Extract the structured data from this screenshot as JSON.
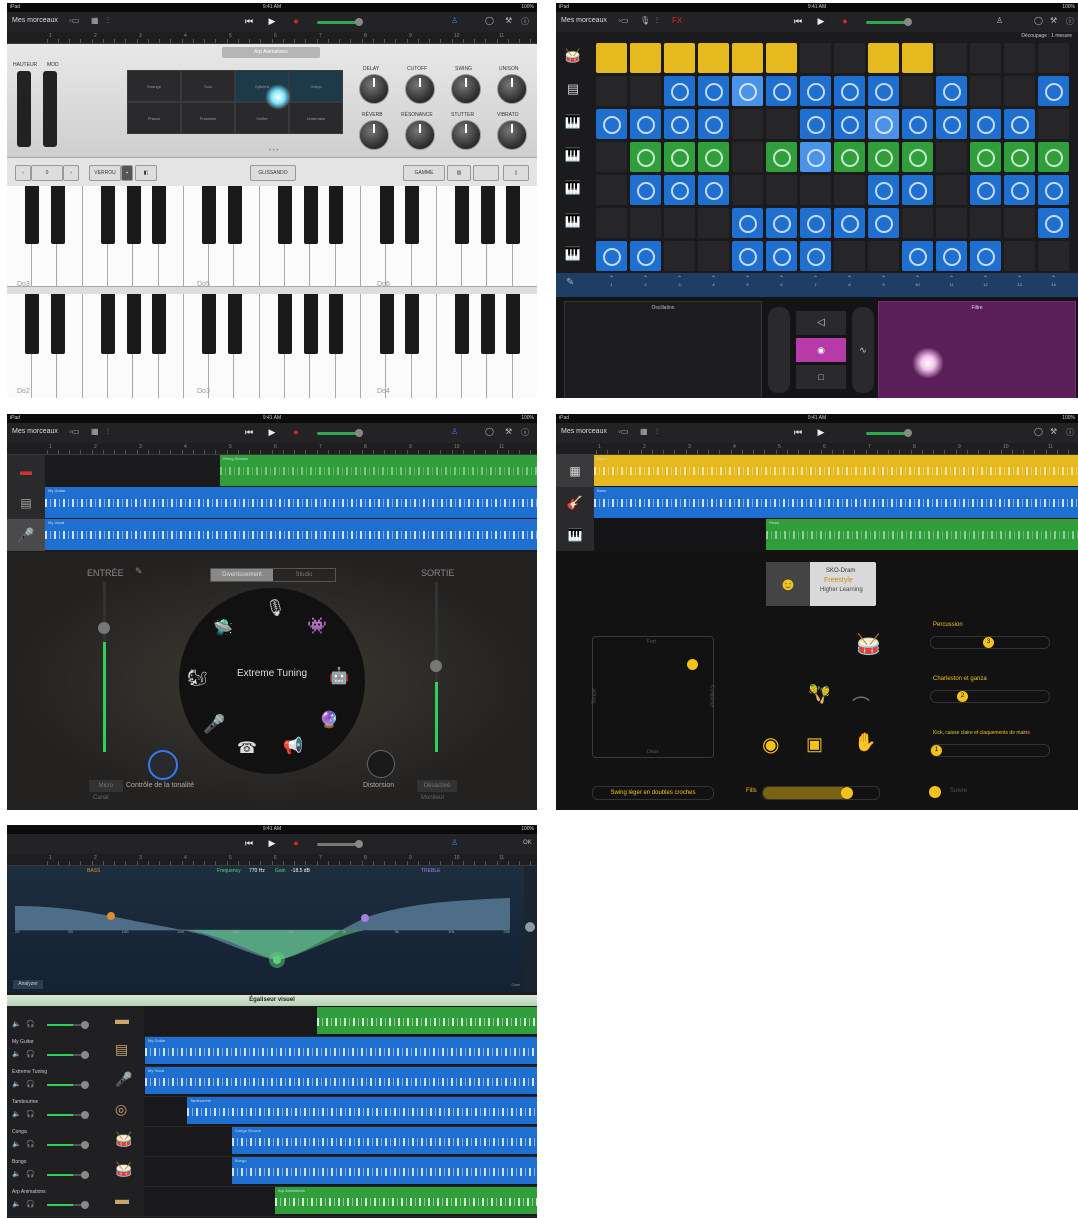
{
  "status": {
    "carrier": "iPad",
    "time": "9:41 AM",
    "battery": "100%"
  },
  "toolbar": {
    "songs_label": "Mes morceaux",
    "fx_label": "FX",
    "ok_label": "OK"
  },
  "ruler_numbers": [
    "1",
    "2",
    "3",
    "4",
    "5",
    "6",
    "7",
    "8",
    "9",
    "10",
    "11"
  ],
  "keyboard_screen": {
    "arp_label": "Arp Animations",
    "pitch_label": "HAUTEUR",
    "mod_label": "MOD",
    "pads": [
      "Strange",
      "Solo",
      "Sylicted",
      "Gokyo",
      "Phasor",
      "Pulsation",
      "Shifter",
      "Undertake"
    ],
    "knobs_top": [
      "DELAY",
      "CUTOFF",
      "SWING",
      "UNISON"
    ],
    "knobs_bottom": [
      "RÉVERB",
      "RÉSONANCE",
      "STUTTER",
      "VIBRATO"
    ],
    "octave_value": "0",
    "lock_label": "VERROU",
    "glissando_label": "GLISSANDO",
    "scale_label": "GAMME",
    "upper_octaves": [
      "Do3",
      "Do5",
      "Do6"
    ],
    "lower_octaves": [
      "Do2",
      "Do3",
      "Do4"
    ]
  },
  "live_loops": {
    "segment_label": "Découpage : 1 mesure",
    "oscillation_label": "Oscillation",
    "filter_label": "Filtre",
    "column_numbers": [
      "1",
      "2",
      "3",
      "4",
      "5",
      "6",
      "7",
      "8",
      "9",
      "10",
      "11",
      "12",
      "13",
      "14"
    ]
  },
  "vocal_screen": {
    "input_label": "ENTRÉE",
    "output_label": "SORTIE",
    "tabs": [
      "Divertissement",
      "Studio"
    ],
    "effect_name": "Extreme Tuning",
    "tone_label": "Contrôle de la tonalité",
    "distortion_label": "Distorsion",
    "mic_label": "Micro",
    "mic_sub": "Canal",
    "monitor_label": "Désactivé",
    "monitor_sub": "Moniteur",
    "tracks": [
      {
        "name": "String Section",
        "color": "#2f9e3b"
      },
      {
        "name": "My Guitar",
        "color": "#1e6fd0"
      },
      {
        "name": "My Vocal",
        "color": "#1e6fd0"
      }
    ]
  },
  "drummer_screen": {
    "drummer_name": "SKO-Dram",
    "drummer_style": "Freestyle",
    "drummer_sub": "Higher Learning",
    "xy_top": "Fort",
    "xy_bottom": "Doux",
    "xy_left": "Simple",
    "xy_right": "Complexe",
    "percussion_label": "Percussion",
    "hihat_label": "Charleston et ganza",
    "kick_label": "Kick, caisse claire et claquements de mains",
    "swing_label": "Swing léger en doubles croches",
    "fills_label": "Fills",
    "follow_label": "Suivre",
    "percussion_value": "3",
    "hihat_value": "2",
    "kick_value": "1",
    "tracks": [
      {
        "name": "Drum",
        "color": "#e6b91e"
      },
      {
        "name": "Bass",
        "color": "#1e6fd0"
      },
      {
        "name": "Piano",
        "color": "#2f9e3b"
      }
    ]
  },
  "eq_screen": {
    "bass_label": "BASS",
    "treble_label": "TREBLE",
    "frequency_label": "Frequency",
    "frequency_value": "770 Hz",
    "gain_label": "Gain",
    "gain_value": "-18.5 dB",
    "freq_ticks": [
      "20",
      "50",
      "100",
      "200",
      "500",
      "1k",
      "2k",
      "5k",
      "10k",
      "20k"
    ],
    "analyzer_label": "Analyzer",
    "gain_side_label": "Gain",
    "eq_title": "Égaliseur visuel",
    "tracks": [
      {
        "name": "",
        "region": ""
      },
      {
        "name": "My Guitar",
        "region": "My Guitar"
      },
      {
        "name": "Extreme Tuning",
        "region": "My Vocal"
      },
      {
        "name": "Tambourine",
        "region": "Tambourine"
      },
      {
        "name": "Conga",
        "region": "Conga Groove"
      },
      {
        "name": "Bongo",
        "region": "Bongo"
      },
      {
        "name": "Arp Animations",
        "region": "Arp Animations"
      }
    ]
  },
  "colors": {
    "green": "#2f9e3b",
    "blue": "#1e6fd0",
    "yellow": "#e6b91e",
    "record": "#e02424",
    "accent": "#3478f6",
    "purple": "#b63aa8"
  }
}
